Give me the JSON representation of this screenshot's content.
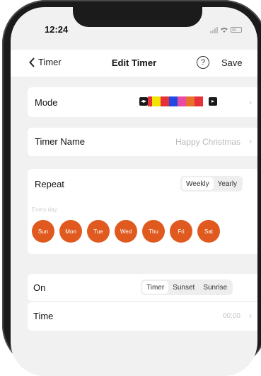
{
  "status": {
    "time": "12:24"
  },
  "nav": {
    "back_label": "Timer",
    "title": "Edit Timer",
    "help_glyph": "?",
    "save_label": "Save"
  },
  "mode": {
    "label": "Mode",
    "start_glyph": "◂▸",
    "end_glyph": "▸",
    "colors": [
      "#e8303a",
      "#f2e400",
      "#e8303a",
      "#2348e2",
      "#e84aa6",
      "#e8712a",
      "#e8303a"
    ]
  },
  "timer_name": {
    "label": "Timer Name",
    "value": "Happy Christmas"
  },
  "repeat": {
    "label": "Repeat",
    "options": [
      "Weekly",
      "Yearly"
    ],
    "every_label": "Every day",
    "days": [
      "Sun",
      "Mon",
      "Tue",
      "Wed",
      "Thu",
      "Fri",
      "Sat"
    ],
    "day_color": "#e05a1f"
  },
  "on": {
    "label": "On",
    "options": [
      "Timer",
      "Sunset",
      "Sunrise"
    ]
  },
  "time": {
    "label": "Time",
    "value": "00:00"
  },
  "chevron_glyph": "›"
}
